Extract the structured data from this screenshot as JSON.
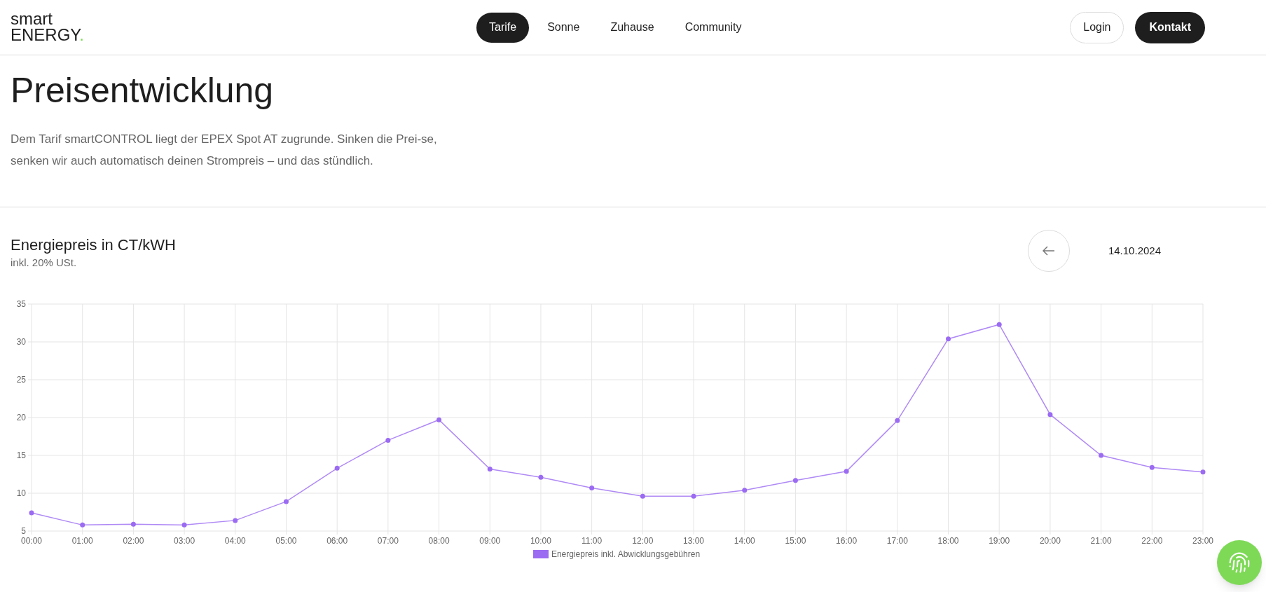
{
  "logo": {
    "line_1": "smart",
    "line_2": "ENERGY",
    "dot": "."
  },
  "nav": [
    {
      "label": "Tarife",
      "selected": true
    },
    {
      "label": "Sonne",
      "selected": false
    },
    {
      "label": "Zuhause",
      "selected": false
    },
    {
      "label": "Community",
      "selected": false
    }
  ],
  "header_buttons": {
    "login": "Login",
    "contact": "Kontakt"
  },
  "hero": {
    "title": "Preisentwicklung",
    "text": "Dem Tarif smartCONTROL liegt der EPEX Spot AT zugrunde. Sinken die Prei-se, senken wir auch automatisch deinen Strompreis – und das stündlich."
  },
  "price_section": {
    "title": "Energiepreis in CT/kWH",
    "subtitle": "inkl. 20% USt.",
    "date": "14.10.2024",
    "chart_data": {
      "type": "line",
      "categories": [
        "00:00",
        "01:00",
        "02:00",
        "03:00",
        "04:00",
        "05:00",
        "06:00",
        "07:00",
        "08:00",
        "09:00",
        "10:00",
        "11:00",
        "12:00",
        "13:00",
        "14:00",
        "15:00",
        "16:00",
        "17:00",
        "18:00",
        "19:00",
        "20:00",
        "21:00",
        "22:00",
        "23:00"
      ],
      "series": [
        {
          "name": "Energiepreis inkl. Abwicklungsgebühren",
          "color": "#9b6bf2",
          "marker": true,
          "values": [
            7.4,
            5.8,
            5.9,
            5.8,
            6.4,
            8.9,
            13.3,
            17.0,
            19.7,
            13.2,
            12.1,
            10.7,
            9.6,
            9.6,
            10.4,
            11.7,
            12.9,
            19.6,
            30.4,
            32.3,
            20.4,
            15.0,
            13.4,
            12.8
          ]
        }
      ],
      "grid": true,
      "ylim": [
        5,
        35
      ],
      "yticks": [
        5,
        10,
        15,
        20,
        25,
        30,
        35
      ]
    }
  }
}
